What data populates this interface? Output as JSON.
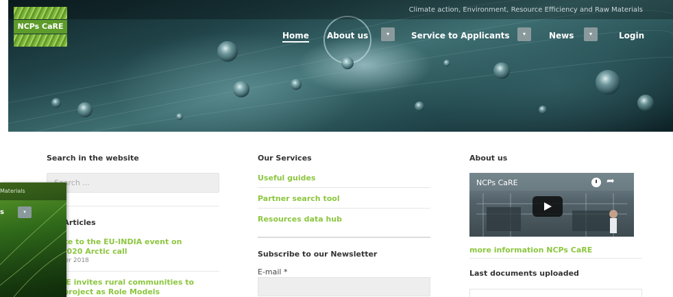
{
  "site": {
    "logo_text": "NCPs CaRE",
    "tagline": "Climate action, Environment, Resource Efficiency and Raw Materials"
  },
  "nav": {
    "home": "Home",
    "about": "About us",
    "service": "Service to Applicants",
    "news": "News",
    "login": "Login",
    "caret": "▾"
  },
  "search_section": {
    "title": "Search in the website",
    "placeholder": "Search ..."
  },
  "articles": {
    "title": "ent Articles",
    "items": [
      {
        "title_line1": "cipate to the EU-INDIA event on",
        "title_line2": "zon2020 Arctic call",
        "date": "October 2018"
      },
      {
        "title_line1": "ITAGE invites rural communities to",
        "title_line2": "the project as Role Models"
      }
    ]
  },
  "services": {
    "title": "Our Services",
    "links": [
      "Useful guides",
      "Partner search tool",
      "Resources data hub"
    ]
  },
  "newsletter": {
    "title": "Subscribe to our Newsletter",
    "email_label": "E-mail",
    "required_mark": "*"
  },
  "about": {
    "title": "About us",
    "video_title": "NCPs CaRE",
    "more_link": "more information NCPs CaRE",
    "last_docs_title": "Last documents uploaded"
  },
  "overlay": {
    "text": "Materials",
    "news_fragment": "s",
    "caret": "▾"
  },
  "colors": {
    "accent_green": "#8cc63f",
    "header_teal": "#2f5a5e"
  }
}
